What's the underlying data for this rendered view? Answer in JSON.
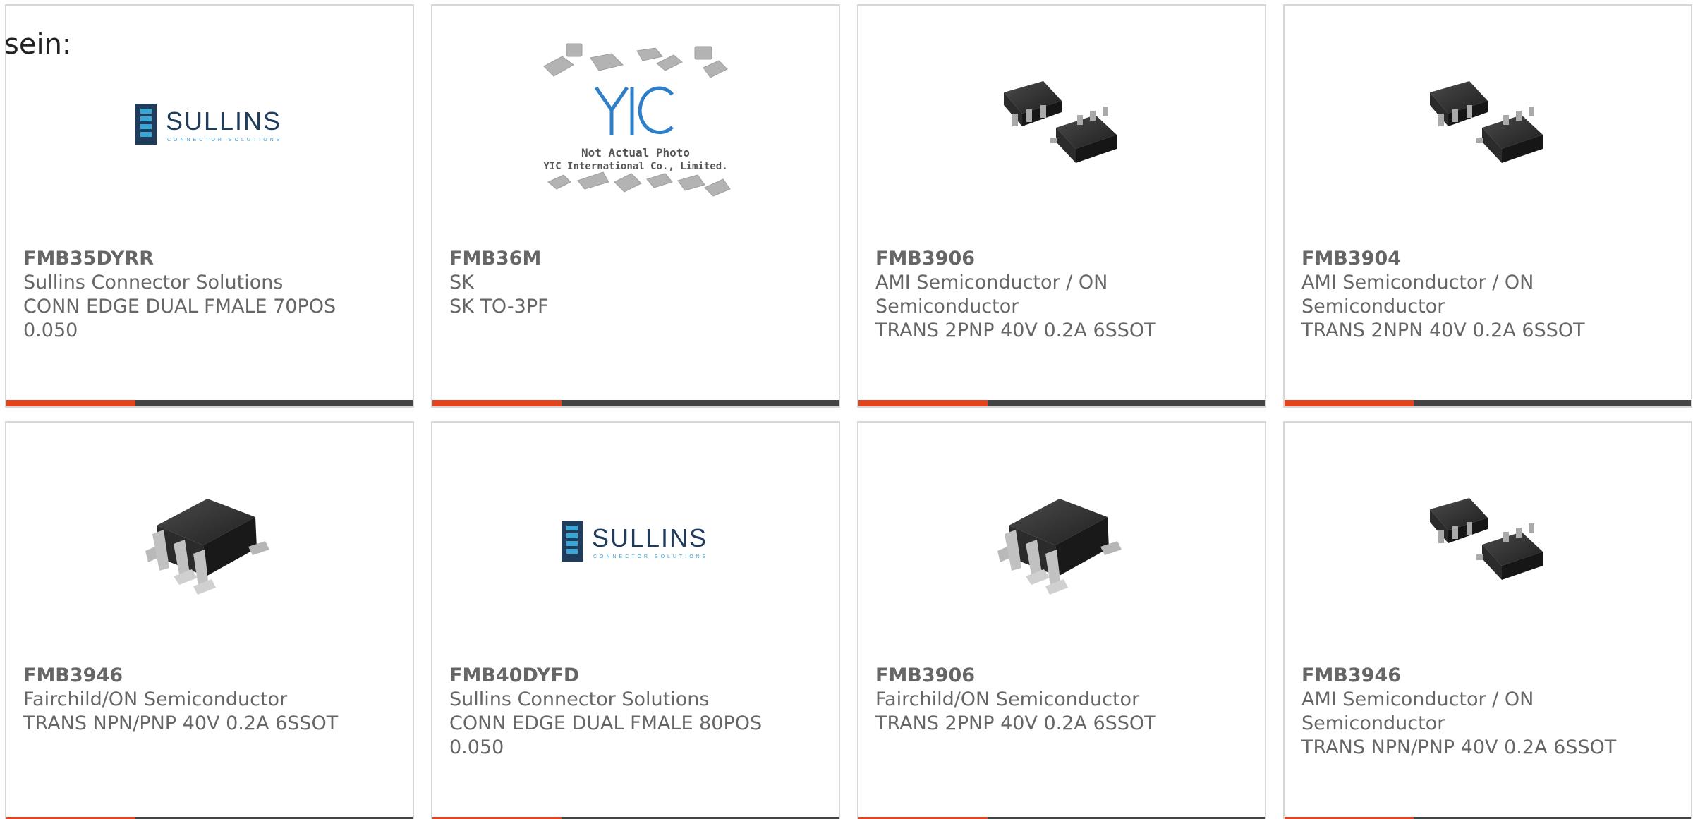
{
  "top_text": "sein:",
  "accent_color": "#e0451f",
  "bar_color": "#444444",
  "cards": [
    {
      "image": "sullins-logo",
      "logo_text": "SULLINS",
      "logo_subtext": "CONNECTOR SOLUTIONS",
      "part_number": "FMB35DYRR",
      "manufacturer": "Sullins Connector Solutions",
      "description_line1": "CONN EDGE DUAL FMALE 70POS",
      "description_line2": "0.050"
    },
    {
      "image": "yic-placeholder",
      "yic_line1": "Not Actual Photo",
      "yic_line2": "YIC International Co., Limited.",
      "part_number": "FMB36M",
      "manufacturer": "SK",
      "description_line1": "SK TO-3PF",
      "description_line2": ""
    },
    {
      "image": "dual-sot-chips",
      "part_number": "FMB3906",
      "manufacturer": "AMI Semiconductor / ON",
      "description_line1": "Semiconductor",
      "description_line2": "TRANS 2PNP 40V 0.2A 6SSOT"
    },
    {
      "image": "dual-sot-chips",
      "part_number": "FMB3904",
      "manufacturer": "AMI Semiconductor / ON",
      "description_line1": "Semiconductor",
      "description_line2": "TRANS 2NPN 40V 0.2A 6SSOT"
    },
    {
      "image": "single-sot-chip",
      "part_number": "FMB3946",
      "manufacturer": "Fairchild/ON Semiconductor",
      "description_line1": "TRANS NPN/PNP 40V 0.2A 6SSOT",
      "description_line2": ""
    },
    {
      "image": "sullins-logo",
      "logo_text": "SULLINS",
      "logo_subtext": "CONNECTOR SOLUTIONS",
      "part_number": "FMB40DYFD",
      "manufacturer": "Sullins Connector Solutions",
      "description_line1": "CONN EDGE DUAL FMALE 80POS",
      "description_line2": "0.050"
    },
    {
      "image": "single-sot-chip",
      "part_number": "FMB3906",
      "manufacturer": "Fairchild/ON Semiconductor",
      "description_line1": "TRANS 2PNP 40V 0.2A 6SSOT",
      "description_line2": ""
    },
    {
      "image": "dual-sot-chips",
      "part_number": "FMB3946",
      "manufacturer": "AMI Semiconductor / ON",
      "description_line1": "Semiconductor",
      "description_line2": "TRANS NPN/PNP 40V 0.2A 6SSOT"
    }
  ]
}
